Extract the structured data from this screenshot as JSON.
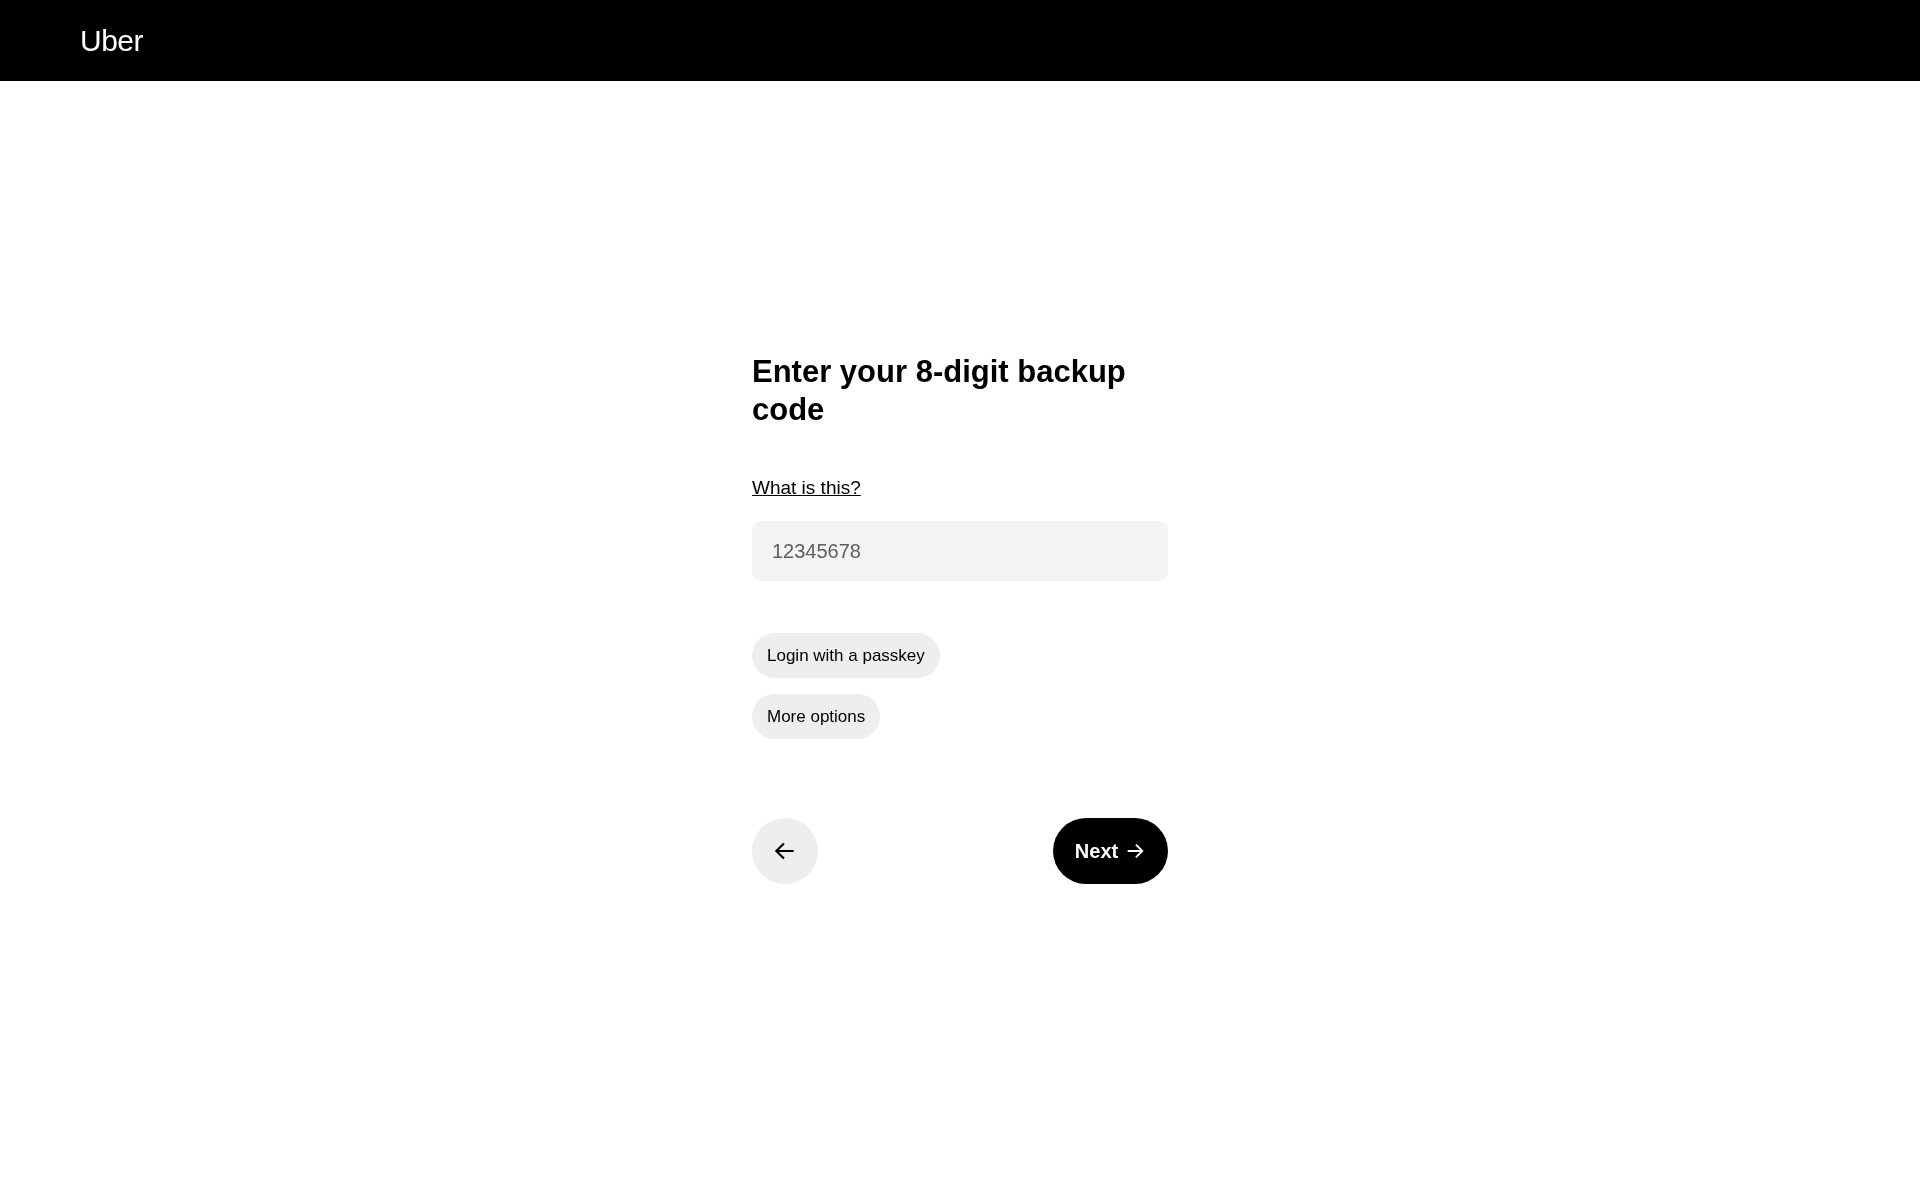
{
  "header": {
    "logo": "Uber"
  },
  "heading": "Enter your 8-digit backup code",
  "help_link": "What is this?",
  "code_field": {
    "placeholder": "12345678"
  },
  "options": [
    "Login with a passkey",
    "More options"
  ],
  "next_button": {
    "label": "Next"
  }
}
